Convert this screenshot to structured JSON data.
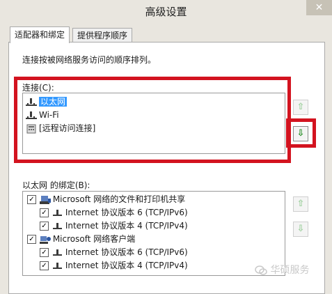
{
  "window": {
    "title": "高级设置",
    "close_glyph": "✕"
  },
  "tabs": [
    {
      "label": "适配器和绑定",
      "active": true
    },
    {
      "label": "提供程序顺序",
      "active": false
    }
  ],
  "panel": {
    "description": "连接按被网络服务访问的顺序排列。",
    "connections": {
      "label": "连接(C):",
      "items": [
        {
          "label": "以太网",
          "selected": true,
          "icon": "network-icon"
        },
        {
          "label": "Wi-Fi",
          "selected": false,
          "icon": "network-icon"
        },
        {
          "label": "[远程访问连接]",
          "selected": false,
          "icon": "remote-access-icon"
        }
      ]
    },
    "bindings": {
      "label": "以太网 的绑定(B):",
      "items": [
        {
          "label": "Microsoft 网络的文件和打印机共享",
          "checked": true,
          "icon": "file-printer-share-icon"
        },
        {
          "label": "Internet 协议版本 6 (TCP/IPv6)",
          "checked": true,
          "icon": "protocol-icon"
        },
        {
          "label": "Internet 协议版本 4 (TCP/IPv4)",
          "checked": true,
          "icon": "protocol-icon"
        },
        {
          "label": "Microsoft 网络客户端",
          "checked": true,
          "icon": "network-client-icon"
        },
        {
          "label": "Internet 协议版本 6 (TCP/IPv6)",
          "checked": true,
          "icon": "protocol-icon"
        },
        {
          "label": "Internet 协议版本 4 (TCP/IPv4)",
          "checked": true,
          "icon": "protocol-icon"
        }
      ]
    },
    "buttons": {
      "up_glyph": "⇧",
      "down_glyph": "⇩"
    }
  },
  "watermark": "华硕服务",
  "colors": {
    "highlight_box": "#d3131f",
    "selection": "#3399ff",
    "arrow_green": "#1f8a1f"
  }
}
